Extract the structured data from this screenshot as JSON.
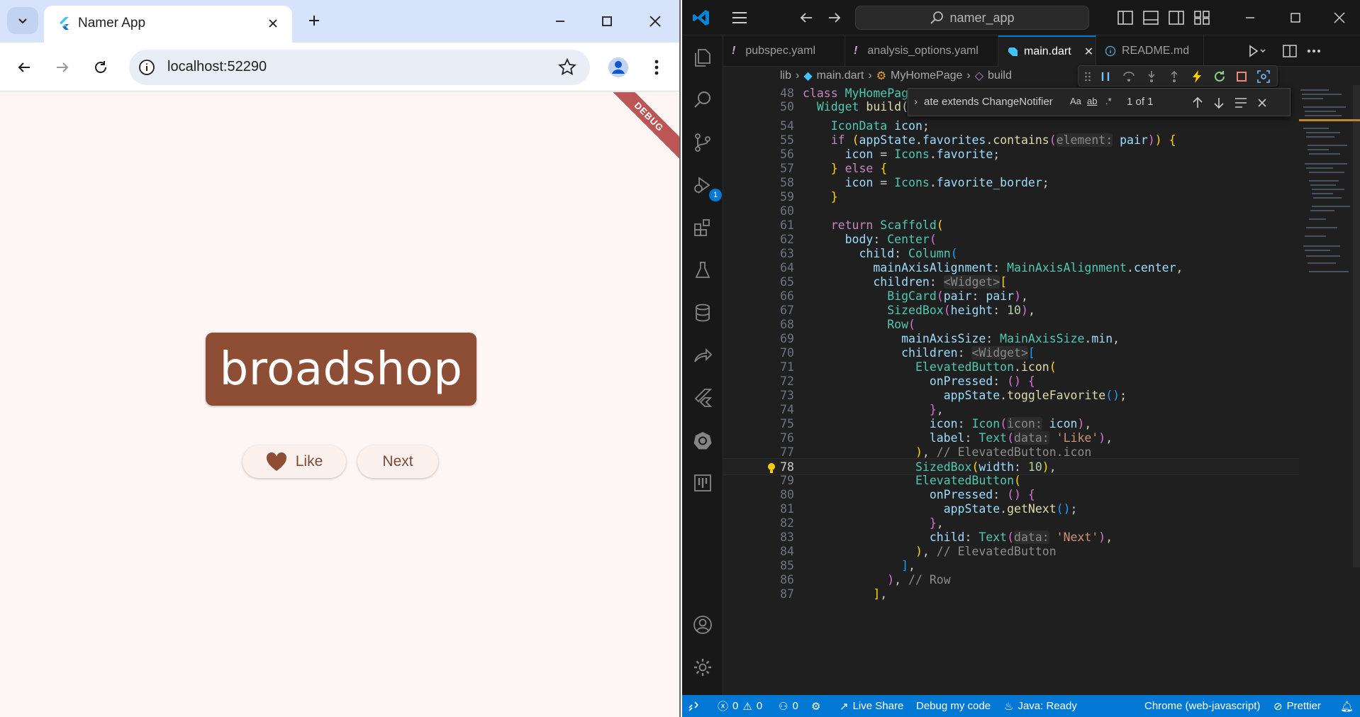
{
  "browser": {
    "tab_title": "Namer App",
    "url": "localhost:52290",
    "debug_banner": "DEBUG"
  },
  "app": {
    "word_pair": "broadshop",
    "like_label": "Like",
    "next_label": "Next",
    "card_color": "#8e4e35",
    "background": "#fef6f4"
  },
  "vscode": {
    "search": "namer_app",
    "tabs": [
      {
        "label": "pubspec.yaml",
        "mark": "!"
      },
      {
        "label": "analysis_options.yaml",
        "mark": "!"
      },
      {
        "label": "main.dart",
        "mark": ""
      },
      {
        "label": "README.md",
        "mark": ""
      }
    ],
    "breadcrumbs": [
      "lib",
      "main.dart",
      "MyHomePage",
      "build"
    ],
    "find": {
      "query": "ate extends ChangeNotifier",
      "opt_case": "Aa",
      "opt_word": "ab",
      "opt_regex": ".*",
      "result": "1 of 1"
    },
    "debug_badge": "1",
    "status": {
      "errors": "0",
      "warnings": "0",
      "ports": "0",
      "live_share": "Live Share",
      "debug": "Debug my code",
      "java": "Java: Ready",
      "target": "Chrome (web-javascript)",
      "prettier": "Prettier"
    }
  },
  "code_lines": [
    {
      "n": "48",
      "html": "<span class=\"k\">class</span> <span class=\"t\">MyHomePage</span> <span class=\"k\">e</span>"
    },
    {
      "n": "50",
      "html": "  <span class=\"t\">Widget</span> <span class=\"f\">build</span>(<span class=\"t\">Bui</span>"
    },
    {
      "n": "54",
      "html": "    <span class=\"t\">IconData</span> <span class=\"v\">icon</span>;"
    },
    {
      "n": "55",
      "html": "    <span class=\"k\">if</span> <span class=\"p\">(</span><span class=\"v\">appState</span>.<span class=\"v\">favorites</span>.<span class=\"f\">contains</span><span class=\"p2\">(</span><span class=\"h\">element:</span> <span class=\"v\">pair</span><span class=\"p2\">)</span><span class=\"p\">)</span> <span class=\"p\">{</span>"
    },
    {
      "n": "56",
      "html": "      <span class=\"v\">icon</span> = <span class=\"t\">Icons</span>.<span class=\"v\">favorite</span>;"
    },
    {
      "n": "57",
      "html": "    <span class=\"p\">}</span> <span class=\"k\">else</span> <span class=\"p\">{</span>"
    },
    {
      "n": "58",
      "html": "      <span class=\"v\">icon</span> = <span class=\"t\">Icons</span>.<span class=\"v\">favorite_border</span>;"
    },
    {
      "n": "59",
      "html": "    <span class=\"p\">}</span>"
    },
    {
      "n": "60",
      "html": ""
    },
    {
      "n": "61",
      "html": "    <span class=\"k\">return</span> <span class=\"t\">Scaffold</span><span class=\"p\">(</span>"
    },
    {
      "n": "62",
      "html": "      <span class=\"v\">body</span>: <span class=\"t\">Center</span><span class=\"p2\">(</span>"
    },
    {
      "n": "63",
      "html": "        <span class=\"v\">child</span>: <span class=\"t\">Column</span><span class=\"p3\">(</span>"
    },
    {
      "n": "64",
      "html": "          <span class=\"v\">mainAxisAlignment</span>: <span class=\"t\">MainAxisAlignment</span>.<span class=\"v\">center</span>,"
    },
    {
      "n": "65",
      "html": "          <span class=\"v\">children</span>: <span class=\"h\">&lt;Widget&gt;</span><span class=\"p\">[</span>"
    },
    {
      "n": "66",
      "html": "            <span class=\"t\">BigCard</span><span class=\"p2\">(</span><span class=\"v\">pair</span>: <span class=\"v\">pair</span><span class=\"p2\">)</span>,"
    },
    {
      "n": "67",
      "html": "            <span class=\"t\">SizedBox</span><span class=\"p2\">(</span><span class=\"v\">height</span>: <span class=\"n\">10</span><span class=\"p2\">)</span>,"
    },
    {
      "n": "68",
      "html": "            <span class=\"t\">Row</span><span class=\"p2\">(</span>"
    },
    {
      "n": "69",
      "html": "              <span class=\"v\">mainAxisSize</span>: <span class=\"t\">MainAxisSize</span>.<span class=\"v\">min</span>,"
    },
    {
      "n": "70",
      "html": "              <span class=\"v\">children</span>: <span class=\"h\">&lt;Widget&gt;</span><span class=\"p3\">[</span>"
    },
    {
      "n": "71",
      "html": "                <span class=\"t\">ElevatedButton</span>.<span class=\"f\">icon</span><span class=\"p\">(</span>"
    },
    {
      "n": "72",
      "html": "                  <span class=\"v\">onPressed</span>: <span class=\"p2\">()</span> <span class=\"p2\">{</span>"
    },
    {
      "n": "73",
      "html": "                    <span class=\"v\">appState</span>.<span class=\"f\">toggleFavorite</span><span class=\"p3\">()</span>;"
    },
    {
      "n": "74",
      "html": "                  <span class=\"p2\">}</span>,"
    },
    {
      "n": "75",
      "html": "                  <span class=\"v\">icon</span>: <span class=\"t\">Icon</span><span class=\"p2\">(</span><span class=\"h\">icon:</span> <span class=\"v\">icon</span><span class=\"p2\">)</span>,"
    },
    {
      "n": "76",
      "html": "                  <span class=\"v\">label</span>: <span class=\"t\">Text</span><span class=\"p2\">(</span><span class=\"h\">data:</span> <span class=\"s\">'Like'</span><span class=\"p2\">)</span>,"
    },
    {
      "n": "77",
      "html": "                <span class=\"p\">)</span>, <span class=\"c\">// ElevatedButton.icon</span>"
    },
    {
      "n": "78",
      "html": "                <span class=\"t\">SizedBox</span><span class=\"p\">(</span><span class=\"v\">width</span>: <span class=\"n\">10</span><span class=\"p\">)</span>,"
    },
    {
      "n": "79",
      "html": "                <span class=\"t\">ElevatedButton</span><span class=\"p\">(</span>"
    },
    {
      "n": "80",
      "html": "                  <span class=\"v\">onPressed</span>: <span class=\"p2\">()</span> <span class=\"p2\">{</span>"
    },
    {
      "n": "81",
      "html": "                    <span class=\"v\">appState</span>.<span class=\"f\">getNext</span><span class=\"p3\">()</span>;"
    },
    {
      "n": "82",
      "html": "                  <span class=\"p2\">}</span>,"
    },
    {
      "n": "83",
      "html": "                  <span class=\"v\">child</span>: <span class=\"t\">Text</span><span class=\"p2\">(</span><span class=\"h\">data:</span> <span class=\"s\">'Next'</span><span class=\"p2\">)</span>,"
    },
    {
      "n": "84",
      "html": "                <span class=\"p\">)</span>, <span class=\"c\">// ElevatedButton</span>"
    },
    {
      "n": "85",
      "html": "              <span class=\"p3\">]</span>,"
    },
    {
      "n": "86",
      "html": "            <span class=\"p2\">)</span>, <span class=\"c\">// Row</span>"
    },
    {
      "n": "87",
      "html": "          <span class=\"p\">]</span>,"
    }
  ]
}
